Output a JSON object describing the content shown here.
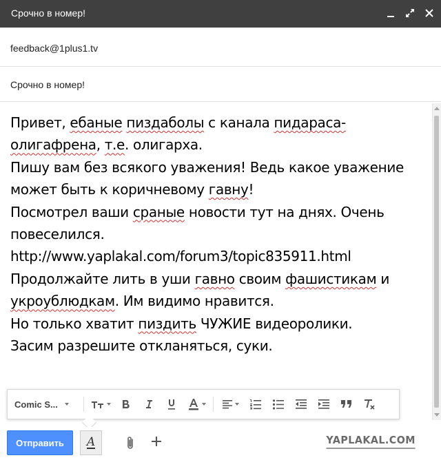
{
  "window": {
    "title": "Срочно в номер!"
  },
  "recipients": {
    "to": "feedback@1plus1.tv"
  },
  "subject": {
    "value": "Срочно в номер!"
  },
  "message": {
    "lines": [
      [
        {
          "t": "Привет, "
        },
        {
          "t": "ебаные",
          "spell": true
        },
        {
          "t": " "
        },
        {
          "t": "пиздаболы",
          "spell": true
        },
        {
          "t": " с канала "
        },
        {
          "t": "пидараса-",
          "spell": true
        }
      ],
      [
        {
          "t": "олигафрена",
          "spell": true
        },
        {
          "t": ", "
        },
        {
          "t": "т.е",
          "spell": true
        },
        {
          "t": ". олигарха."
        }
      ],
      [
        {
          "t": "Пишу вам без всякого уважения! Ведь какое уважение"
        }
      ],
      [
        {
          "t": "может быть к коричневому "
        },
        {
          "t": "гавну",
          "spell": true
        },
        {
          "t": "!"
        }
      ],
      [
        {
          "t": "Посмотрел ваши "
        },
        {
          "t": "сраные",
          "spell": true
        },
        {
          "t": " новости тут на днях. Очень"
        }
      ],
      [
        {
          "t": "повеселился."
        }
      ],
      [
        {
          "t": "http://www.yaplakal.com/forum3/topic835911.html"
        }
      ],
      [
        {
          "t": "Продолжайте лить в уши "
        },
        {
          "t": "гавно",
          "spell": true
        },
        {
          "t": " своим "
        },
        {
          "t": "фашистикам",
          "spell": true
        },
        {
          "t": " и"
        }
      ],
      [
        {
          "t": "укроублюдкам",
          "spell": true
        },
        {
          "t": ". Им видимо нравится."
        }
      ],
      [
        {
          "t": "Но только хватит "
        },
        {
          "t": "пиздить",
          "spell": true
        },
        {
          "t": " ЧУЖИЕ видеоролики."
        }
      ],
      [
        {
          "t": "Засим разрешите откланяться, суки."
        }
      ]
    ]
  },
  "format_toolbar": {
    "font_label": "Comic S..."
  },
  "actions": {
    "send_label": "Отправить"
  },
  "watermark": {
    "text": "YAPLAKAL.COM"
  },
  "colors": {
    "titlebar": "#404040",
    "send_button": "#4d90fe",
    "spellcheck": "#d32f2f"
  }
}
